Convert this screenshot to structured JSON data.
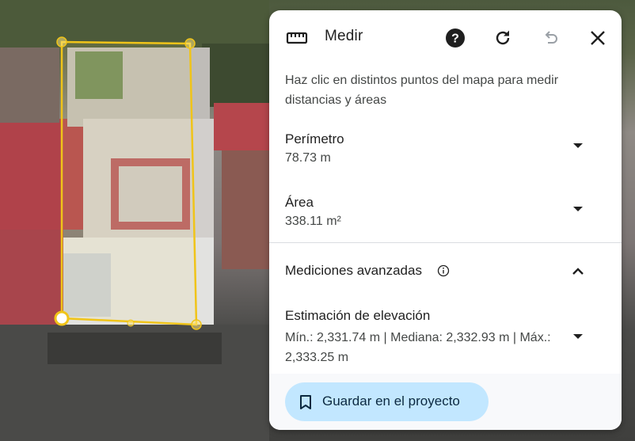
{
  "panel": {
    "title": "Medir",
    "icons": {
      "ruler": "ruler-icon",
      "help": "help-icon",
      "refresh": "refresh-icon",
      "undo": "undo-icon",
      "close": "close-icon"
    },
    "instructions": "Haz clic en distintos puntos del mapa para medir distancias y áreas",
    "perimeter": {
      "label": "Perímetro",
      "value": "78.73 m"
    },
    "area": {
      "label": "Área",
      "value": "338.11 m²"
    },
    "advanced": {
      "label": "Mediciones avanzadas",
      "info_icon": "info-icon",
      "expanded": true
    },
    "elevation": {
      "label": "Estimación de elevación",
      "value": "Mín.: 2,331.74 m | Mediana: 2,332.93 m | Máx.: 2,333.25 m"
    },
    "save_button": {
      "label": "Guardar en el proyecto",
      "icon": "bookmark-icon"
    }
  },
  "colors": {
    "accent_button": "#c2e7ff",
    "measure_line": "#f0c419",
    "text_primary": "#1f1f1f",
    "text_secondary": "#444746"
  }
}
